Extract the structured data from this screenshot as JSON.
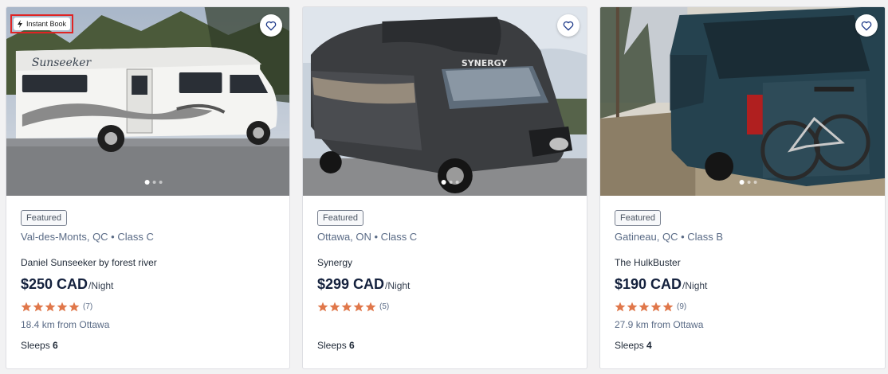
{
  "listings": [
    {
      "instant_book": "Instant Book",
      "badge": "Featured",
      "location": "Val-des-Monts, QC • Class C",
      "name": "Daniel Sunseeker by forest river",
      "price": "$250 CAD",
      "price_unit": "/Night",
      "rating_count": "(7)",
      "stars": 5,
      "distance": "18.4 km from Ottawa",
      "sleeps_label": "Sleeps",
      "sleeps": "6",
      "photo_alt": "sunseeker-rv-photo",
      "image_text": "Sunseeker"
    },
    {
      "badge": "Featured",
      "location": "Ottawa, ON • Class C",
      "name": "Synergy",
      "price": "$299 CAD",
      "price_unit": "/Night",
      "rating_count": "(5)",
      "stars": 5,
      "distance": "",
      "sleeps_label": "Sleeps",
      "sleeps": "6",
      "photo_alt": "synergy-rv-photo",
      "image_text": "SYNERGY"
    },
    {
      "badge": "Featured",
      "location": "Gatineau, QC • Class B",
      "name": "The HulkBuster",
      "price": "$190 CAD",
      "price_unit": "/Night",
      "rating_count": "(9)",
      "stars": 5,
      "distance": "27.9 km from Ottawa",
      "sleeps_label": "Sleeps",
      "sleeps": "4",
      "photo_alt": "hulkbuster-van-photo"
    }
  ],
  "colors": {
    "star": "#e0774a",
    "heart": "#1e3a8a",
    "instant_book_outline": "#e02424"
  }
}
